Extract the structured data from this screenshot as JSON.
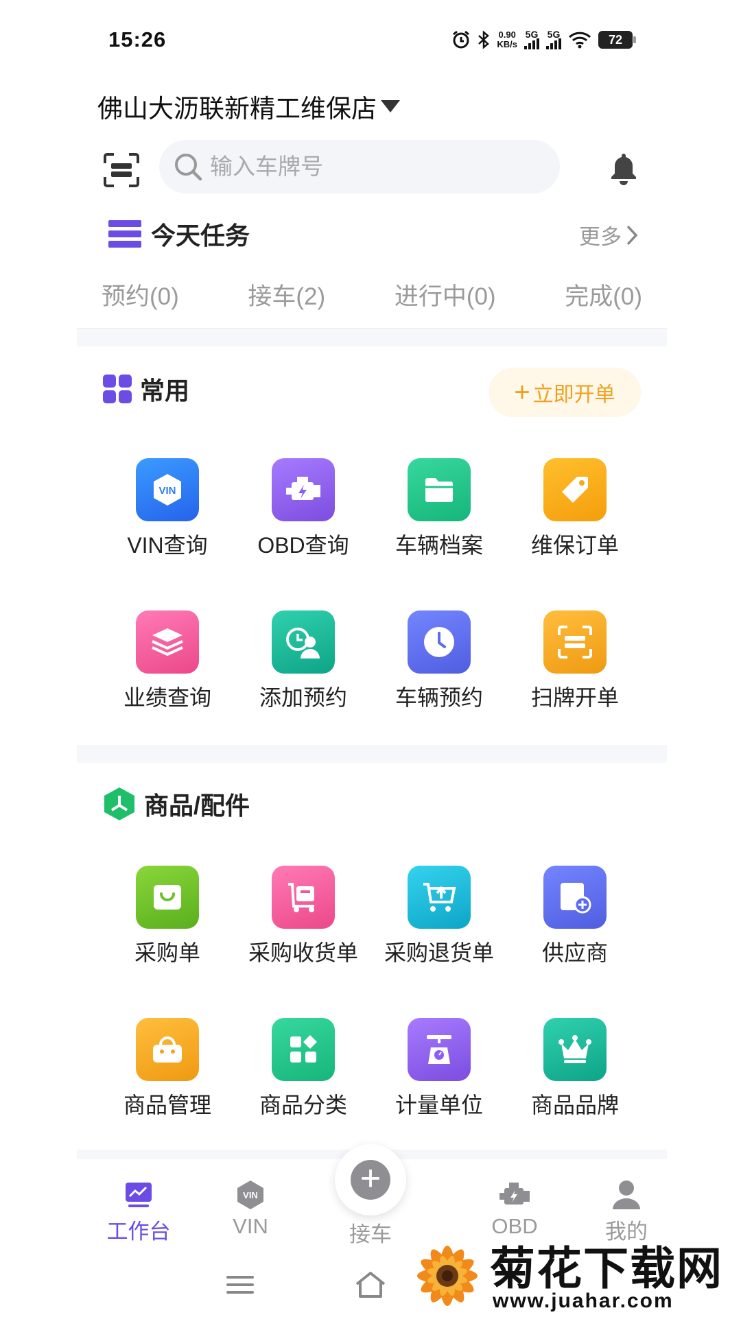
{
  "status_bar": {
    "time": "15:26",
    "speed_value": "0.90",
    "speed_unit": "KB/s",
    "network_1": "5G",
    "network_2": "5G",
    "battery": "72"
  },
  "header": {
    "store_name": "佛山大沥联新精工维保店",
    "search_placeholder": "输入车牌号"
  },
  "today_tasks": {
    "title": "今天任务",
    "more_label": "更多",
    "tabs": [
      {
        "label": "预约(0)"
      },
      {
        "label": "接车(2)"
      },
      {
        "label": "进行中(0)"
      },
      {
        "label": "完成(0)"
      }
    ]
  },
  "common": {
    "title": "常用",
    "open_order_label": "立即开单",
    "items": [
      {
        "label": "VIN查询",
        "icon": "vin-icon",
        "color": "#2f7df6"
      },
      {
        "label": "OBD查询",
        "icon": "engine-icon",
        "color": "#8b5cf6"
      },
      {
        "label": "车辆档案",
        "icon": "folder-icon",
        "color": "#22c58b"
      },
      {
        "label": "维保订单",
        "icon": "tag-icon",
        "color": "#f7a81b"
      },
      {
        "label": "业绩查询",
        "icon": "layers-icon",
        "color": "#f0559a"
      },
      {
        "label": "添加预约",
        "icon": "add-appointment-icon",
        "color": "#1db89a"
      },
      {
        "label": "车辆预约",
        "icon": "clock-icon",
        "color": "#5b6cf0"
      },
      {
        "label": "扫牌开单",
        "icon": "scan-icon",
        "color": "#f3a31e"
      }
    ]
  },
  "goods": {
    "title": "商品/配件",
    "items": [
      {
        "label": "采购单",
        "icon": "shopping-bag-icon",
        "color": "#6cc02a"
      },
      {
        "label": "采购收货单",
        "icon": "receive-cart-icon",
        "color": "#f0559a"
      },
      {
        "label": "采购退货单",
        "icon": "return-cart-icon",
        "color": "#19b6d8"
      },
      {
        "label": "供应商",
        "icon": "supplier-icon",
        "color": "#5b6cf0"
      },
      {
        "label": "商品管理",
        "icon": "basket-icon",
        "color": "#f3a31e"
      },
      {
        "label": "商品分类",
        "icon": "category-icon",
        "color": "#1fbf86"
      },
      {
        "label": "计量单位",
        "icon": "scale-icon",
        "color": "#8b5cf6"
      },
      {
        "label": "商品品牌",
        "icon": "crown-icon",
        "color": "#1db89a"
      }
    ]
  },
  "tabbar": {
    "tabs": [
      {
        "label": "工作台",
        "icon": "dashboard-icon"
      },
      {
        "label": "VIN",
        "icon": "vin-icon"
      },
      {
        "label": "OBD",
        "icon": "engine-icon"
      },
      {
        "label": "我的",
        "icon": "user-icon"
      }
    ],
    "center_label": "接车"
  },
  "watermark": {
    "text": "菊花下载网",
    "url": "www.juahar.com"
  }
}
